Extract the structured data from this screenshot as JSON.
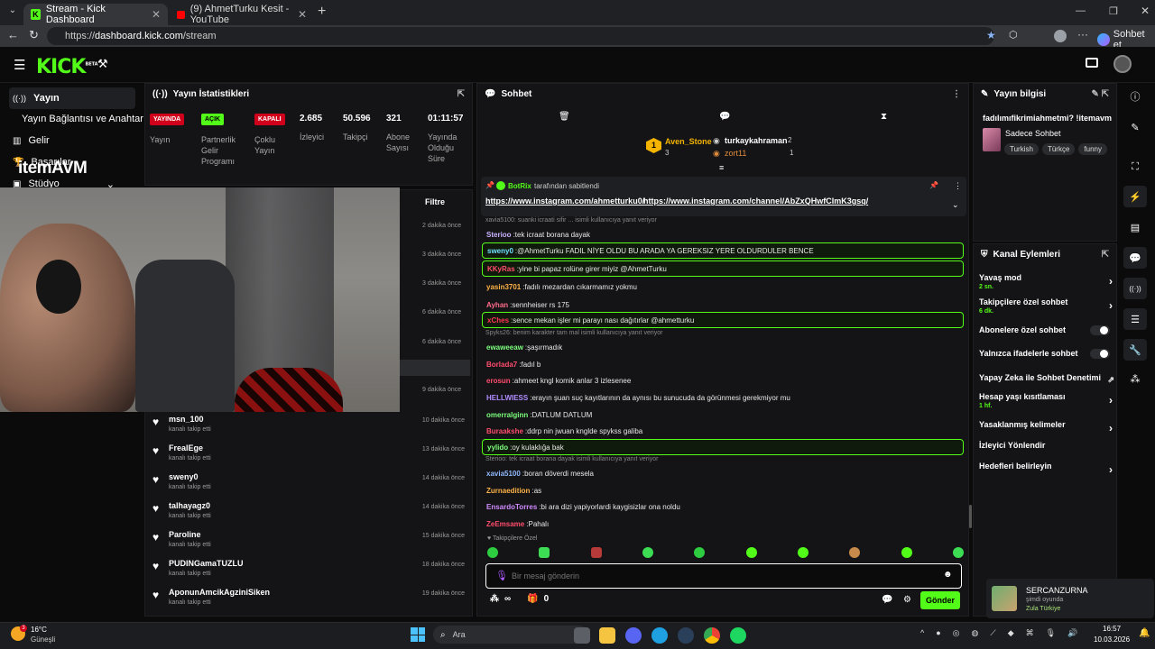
{
  "browser": {
    "tabs": [
      {
        "title": "Stream - Kick Dashboard",
        "active": true
      },
      {
        "title": "(9) AhmetTurku Kesit - YouTube",
        "active": false
      }
    ],
    "url_scheme": "https://",
    "url_host": "dashboard.kick.com",
    "url_path": "/stream",
    "copilot_label": "Sohbet et"
  },
  "header": {
    "logo": "KICK",
    "logo_beta": "BETA"
  },
  "sidebar": {
    "items": [
      {
        "label": "Yayın",
        "icon": "broadcast-icon",
        "active": true
      },
      {
        "label": "Yayın Bağlantısı ve Anahtarı",
        "icon": "",
        "active": false
      },
      {
        "label": "Gelir",
        "icon": "chart-icon",
        "active": false
      },
      {
        "label": "Başarılar",
        "icon": "trophy-icon",
        "active": false
      },
      {
        "label": "Stüdyo",
        "icon": "studio-icon",
        "active": false
      }
    ],
    "overlay_logo": "itemAVM"
  },
  "stats": {
    "title": "Yayın İstatistikleri",
    "badges": [
      {
        "text": "YAYINDA",
        "label": "Yayın",
        "color": "#d0021b"
      },
      {
        "text": "AÇIK",
        "label": "Partnerlik Gelir Programı",
        "color": "#53fc18"
      },
      {
        "text": "KAPALI",
        "label": "Çoklu Yayın",
        "color": "#d0021b"
      }
    ],
    "values": [
      {
        "value": "2.685",
        "label": "İzleyici"
      },
      {
        "value": "50.596",
        "label": "Takipçi"
      },
      {
        "value": "321",
        "label": "Abone Sayısı"
      },
      {
        "value": "01:11:57",
        "label": "Yayında Olduğu Süre"
      }
    ]
  },
  "activity": {
    "filter_label": "Filtre",
    "hidden_times": [
      "2 dakika önce",
      "3 dakika önce",
      "3 dakika önce",
      "6 dakika önce",
      "6 dakika önce",
      "9 dakika önce"
    ],
    "followers": [
      {
        "name": "msn_100",
        "sub": "kanalı takip etti",
        "time": "10 dakika önce"
      },
      {
        "name": "FrealEge",
        "sub": "kanalı takip etti",
        "time": "13 dakika önce"
      },
      {
        "name": "sweny0",
        "sub": "kanalı takip etti",
        "time": "14 dakika önce"
      },
      {
        "name": "talhayagz0",
        "sub": "kanalı takip etti",
        "time": "14 dakika önce"
      },
      {
        "name": "Paroline",
        "sub": "kanalı takip etti",
        "time": "15 dakika önce"
      },
      {
        "name": "PUDINGamaTUZLU",
        "sub": "kanalı takip etti",
        "time": "18 dakika önce"
      },
      {
        "name": "AponunAmcikAgziniSiken",
        "sub": "kanalı takip etti",
        "time": "19 dakika önce"
      }
    ]
  },
  "chat": {
    "title": "Sohbet",
    "leaders": [
      {
        "rank": "1",
        "name": "Aven_Stone",
        "count": "3"
      },
      {
        "rank": "",
        "name": "turkaykahraman",
        "count": "2"
      },
      {
        "rank": "",
        "name": "zort11",
        "count": "1"
      }
    ],
    "pinned": {
      "author": "BotRix",
      "note": "tarafından sabitlendi",
      "text1": "https://www.instagram.com/ahmetturku0/",
      "text2": "https://www.instagram.com/channel/AbZxQHwfClmK3gsq/"
    },
    "messages": [
      {
        "kind": "reply",
        "text": "xavia5100: suanki icraati sifir ... isimli kullanıcıya yanıt veriyor"
      },
      {
        "kind": "msg",
        "user": "Sterioo",
        "color": "#c9b3ff",
        "text": "tek icraat borana dayak",
        "hl": false
      },
      {
        "kind": "msg",
        "user": "sweny0",
        "color": "#6fe0ff",
        "text": "@AhmetTurku FADIL NİYE OLDU BU ARADA YA GEREKSIZ YERE OLDURDULER BENCE",
        "hl": true
      },
      {
        "kind": "msg",
        "user": "KKyRas",
        "color": "#ff4d6d",
        "text": "yine bi papaz rolüne girer miyiz @AhmetTurku",
        "hl": true
      },
      {
        "kind": "msg",
        "user": "yasin3701",
        "color": "#ffb347",
        "text": "fadılı mezardan cıkarmamız yokmu",
        "hl": false
      },
      {
        "kind": "msg",
        "user": "Ayhan",
        "color": "#ff6b8a",
        "text": "sennheiser rs 175",
        "hl": false
      },
      {
        "kind": "msg",
        "user": "xChes",
        "color": "#ff3355",
        "text": "sence mekan işler mi parayı nası dağıtırlar @ahmetturku",
        "hl": true
      },
      {
        "kind": "reply",
        "text": "Spyks26: benim karakter tam mal isimli kullanıcıya yanıt veriyor"
      },
      {
        "kind": "msg",
        "user": "ewaweeaw",
        "color": "#7dff7d",
        "text": "şaşırmadık",
        "hl": false
      },
      {
        "kind": "msg",
        "user": "Borlada7",
        "color": "#ff4d6d",
        "text": "fadıl b",
        "hl": false
      },
      {
        "kind": "msg",
        "user": "erosun",
        "color": "#ff4d6d",
        "text": "ahmeet kngl komik anlar 3 izlesenee",
        "hl": false
      },
      {
        "kind": "msg",
        "user": "HELLWIESS",
        "color": "#b08cff",
        "text": "erayın şuan suç kayıtlarının da aynısı bu sunucuda da görünmesi gerekmiyor mu",
        "hl": false
      },
      {
        "kind": "msg",
        "user": "omerralginn",
        "color": "#7dff7d",
        "text": "DATLUM DATLUM",
        "hl": false
      },
      {
        "kind": "msg",
        "user": "Buraakshe",
        "color": "#ff4d6d",
        "text": "ddrp nin jwuan knglde spykss galiba",
        "hl": false
      },
      {
        "kind": "msg",
        "user": "yylido",
        "color": "#7dff7d",
        "text": "oy kulaklığa bak",
        "hl": true
      },
      {
        "kind": "reply",
        "text": "Sterioo: tek icraat borana dayak isimli kullanıcıya yanıt veriyor"
      },
      {
        "kind": "msg",
        "user": "xavia5100",
        "color": "#8fb8ff",
        "text": "boran döverdi mesela",
        "hl": false
      },
      {
        "kind": "msg",
        "user": "Zurnaedition",
        "color": "#ffb347",
        "text": "as",
        "hl": false
      },
      {
        "kind": "msg",
        "user": "EnsardoTorres",
        "color": "#d08cff",
        "text": "bi ara dizi yapiyorlardi kaygisizlar ona noldu",
        "hl": false
      },
      {
        "kind": "msg",
        "user": "ZeEmsame",
        "color": "#ff4d6d",
        "text": "Pahalı",
        "hl": false
      }
    ],
    "followers_only": "Takipçilere Özel",
    "input_placeholder": "Bir mesaj gönderin",
    "infinity": "∞",
    "count": "0",
    "send_label": "Gönder"
  },
  "info": {
    "title": "Yayın bilgisi",
    "stream_title": "fadılımıfikrimiahmetmi? !itemavm",
    "category": "Sadece Sohbet",
    "tags": [
      "Turkish",
      "Türkçe",
      "funny"
    ]
  },
  "actions": {
    "title": "Kanal Eylemleri",
    "items": [
      {
        "label": "Yavaş mod",
        "sub": "2 sn.",
        "ctrl": "chevron"
      },
      {
        "label": "Takipçilere özel sohbet",
        "sub": "6 dk.",
        "ctrl": "chevron"
      },
      {
        "label": "Abonelere özel sohbet",
        "sub": "",
        "ctrl": "toggle"
      },
      {
        "label": "Yalnızca ifadelerle sohbet",
        "sub": "",
        "ctrl": "toggle"
      },
      {
        "label": "Yapay Zeka ile Sohbet Denetimi",
        "sub": "",
        "ctrl": "external"
      },
      {
        "label": "Hesap yaşı kısıtlaması",
        "sub": "1 hf.",
        "ctrl": "chevron"
      },
      {
        "label": "Yasaklanmış kelimeler",
        "sub": "",
        "ctrl": "chevron"
      },
      {
        "label": "İzleyici Yönlendir",
        "sub": "",
        "ctrl": "none"
      },
      {
        "label": "Hedefleri belirleyin",
        "sub": "",
        "ctrl": "chevron"
      }
    ]
  },
  "notification": {
    "name": "SERCANZURNA",
    "status": "şimdi oyunda",
    "game": "Zula Türkiye"
  },
  "taskbar": {
    "weather_temp": "16°C",
    "weather_desc": "Güneşli",
    "weather_badge": "3",
    "search": "Ara",
    "time": "16:57",
    "date": "10.03.2026"
  },
  "colors": {
    "kick_green": "#53fc18",
    "live_red": "#d0021b",
    "panel_bg": "#141416"
  }
}
